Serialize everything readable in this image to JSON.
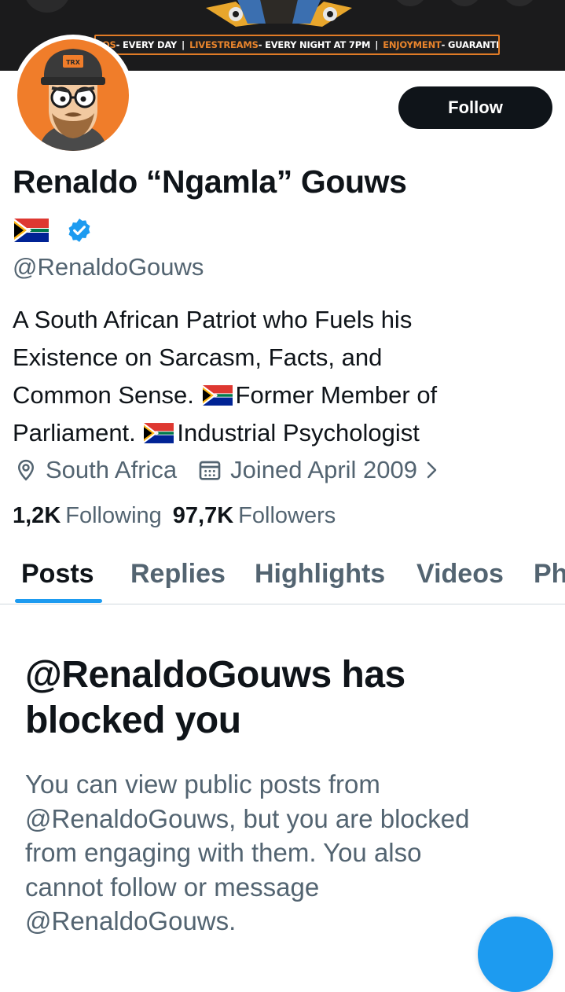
{
  "banner": {
    "tagline": [
      {
        "highlight": "VIDEOS",
        "text": " - EVERY DAY"
      },
      {
        "highlight": "LIVESTREAMS",
        "text": " - EVERY NIGHT AT 7PM"
      },
      {
        "highlight": "ENJOYMENT",
        "text": " - GUARANTEED"
      }
    ],
    "separator": "|",
    "accent_color": "#e8842c"
  },
  "profile": {
    "avatar_cap_text": "TRX",
    "name": "Renaldo “Ngamla” Gouws",
    "handle": "@RenaldoGouws",
    "flag_icon": "south-africa-flag-icon",
    "verified_icon": "verified-badge-icon",
    "bio_lines": [
      "A South African Patriot who Fuels his",
      "Existence on Sarcasm, Facts, and",
      "Common Sense.",
      "Former Member of",
      "Parliament.",
      "Industrial Psychologist"
    ],
    "location": "South Africa",
    "joined": "Joined April 2009",
    "following_count": "1,2K",
    "following_label": "Following",
    "followers_count": "97,7K",
    "followers_label": "Followers"
  },
  "actions": {
    "follow_label": "Follow"
  },
  "tabs": [
    {
      "label": "Posts",
      "active": true
    },
    {
      "label": "Replies",
      "active": false
    },
    {
      "label": "Highlights",
      "active": false
    },
    {
      "label": "Videos",
      "active": false
    },
    {
      "label": "Ph",
      "active": false
    }
  ],
  "blocked": {
    "title_lines": [
      "@RenaldoGouws has",
      "blocked you"
    ],
    "description_lines": [
      "You can view public posts from",
      "@RenaldoGouws, but you are blocked",
      "from engaging with them. You also",
      "cannot follow or message",
      "@RenaldoGouws."
    ]
  },
  "colors": {
    "text_primary": "#0f1419",
    "text_secondary": "#536471",
    "accent_blue": "#1d9bf0",
    "avatar_bg": "#f07d2a"
  }
}
